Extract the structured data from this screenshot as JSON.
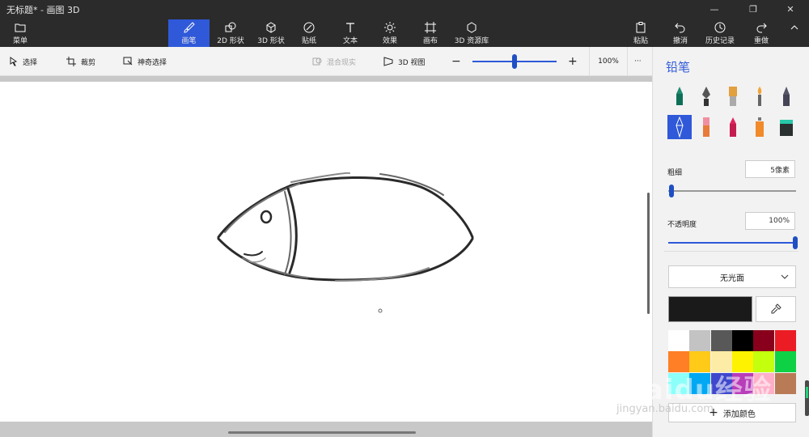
{
  "window": {
    "title": "无标题* - 画图 3D",
    "controls": [
      "minimize",
      "restore",
      "close"
    ]
  },
  "ribbon": {
    "menu_label": "菜单",
    "tabs": [
      {
        "label": "画笔",
        "icon": "brush-icon",
        "active": true
      },
      {
        "label": "2D 形状",
        "icon": "shapes-2d-icon",
        "active": false
      },
      {
        "label": "3D 形状",
        "icon": "cube-icon",
        "active": false
      },
      {
        "label": "贴纸",
        "icon": "sticker-icon",
        "active": false
      },
      {
        "label": "文本",
        "icon": "text-icon",
        "active": false
      },
      {
        "label": "效果",
        "icon": "effects-icon",
        "active": false
      },
      {
        "label": "画布",
        "icon": "canvas-icon",
        "active": false
      },
      {
        "label": "3D 资源库",
        "icon": "library-icon",
        "active": false
      }
    ],
    "right_actions": [
      {
        "label": "粘贴",
        "icon": "paste-icon"
      },
      {
        "label": "撤消",
        "icon": "undo-icon"
      },
      {
        "label": "历史记录",
        "icon": "history-icon"
      },
      {
        "label": "重做",
        "icon": "redo-icon"
      }
    ]
  },
  "toolbar": {
    "select_label": "选择",
    "crop_label": "裁剪",
    "magic_select_label": "神奇选择",
    "mixed_reality_label": "混合现实",
    "view3d_label": "3D 视图",
    "zoom_value": "100%",
    "zoom_level": 0.5,
    "more_label": "···"
  },
  "panel": {
    "title": "铅笔",
    "brushes": [
      "marker",
      "calligraphy-pen",
      "oil-brush",
      "watercolor",
      "pixel-pen",
      "pencil",
      "eraser",
      "crayon",
      "spray-can",
      "fill"
    ],
    "selected_brush": "pencil",
    "thickness_label": "粗细",
    "thickness_value": "5像素",
    "thickness_level": 0.01,
    "opacity_label": "不透明度",
    "opacity_value": "100%",
    "opacity_level": 1.0,
    "finish_label": "无光面",
    "current_color": "#1a1a1a",
    "palette": [
      "#ffffff",
      "#c3c3c3",
      "#585858",
      "#000000",
      "#88001b",
      "#ec1c24",
      "#ff7f27",
      "#ffca18",
      "#fdeca6",
      "#fff200",
      "#c4ff0e",
      "#0ed145",
      "#8cfffb",
      "#00a8f3",
      "#3f48cc",
      "#b83dba",
      "#ffaec8",
      "#b97a56"
    ],
    "add_color_label": "添加颜色"
  },
  "watermark": {
    "text": "Baidu经验",
    "url": "jingyan.baidu.com"
  }
}
